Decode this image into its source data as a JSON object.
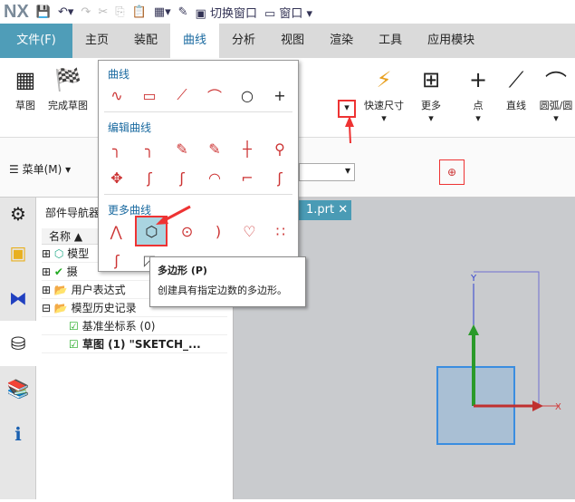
{
  "app": {
    "logo": "NX"
  },
  "quick_access": {
    "switch_window": "切换窗口",
    "window": "窗口"
  },
  "tabs": [
    {
      "label": "文件(F)"
    },
    {
      "label": "主页"
    },
    {
      "label": "装配"
    },
    {
      "label": "曲线"
    },
    {
      "label": "分析"
    },
    {
      "label": "视图"
    },
    {
      "label": "渲染"
    },
    {
      "label": "工具"
    },
    {
      "label": "应用模块"
    }
  ],
  "ribbon": {
    "sketch": "草图",
    "finish_sketch": "完成草图",
    "quick_dim": "快速尺寸",
    "more": "更多",
    "point": "点",
    "line": "直线",
    "arc": "圆弧/圆"
  },
  "menu_button": "菜单(M)",
  "popup": {
    "sections": [
      {
        "title": "曲线"
      },
      {
        "title": "编辑曲线"
      },
      {
        "title": "更多曲线"
      }
    ]
  },
  "tooltip": {
    "title": "多边形 (P)",
    "desc": "创建具有指定边数的多边形。"
  },
  "navigator": {
    "title": "部件导航器",
    "column": "名称",
    "rows": [
      {
        "label": "模型"
      },
      {
        "label": "摄"
      },
      {
        "label": "用户表达式"
      },
      {
        "label": "模型历史记录"
      },
      {
        "label": "基准坐标系 (0)"
      },
      {
        "label": "草图 (1) \"SKETCH_..."
      }
    ]
  },
  "viewport": {
    "tab": "1.prt",
    "axis_y": "Y",
    "axis_x": "X"
  },
  "colors": {
    "file_tab": "#4f9db8",
    "accent": "#1a6aa0",
    "highlight": "#e33333"
  }
}
